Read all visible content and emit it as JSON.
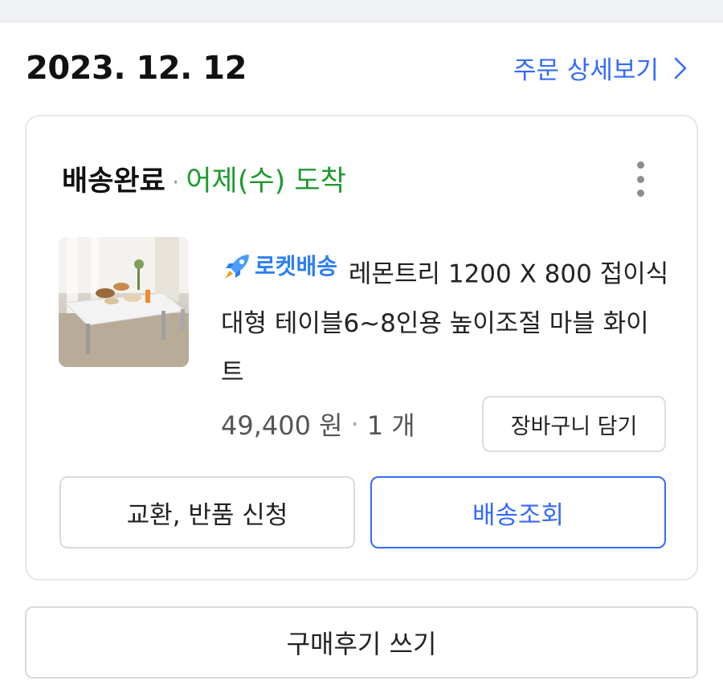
{
  "order": {
    "date": "2023. 12. 12",
    "detail_link": "주문 상세보기"
  },
  "card": {
    "status": "배송완료",
    "status_separator": "·",
    "arrival": "어제(수) 도착",
    "more_icon": "more-vertical-icon",
    "product": {
      "thumbnail_icon": "product-table-image",
      "badge_icon": "rocket-icon",
      "badge_label": "로켓배송",
      "title": "레몬트리 1200 X 800 접이식 대형 테이블6~8인용 높이조절 마블 화이트",
      "price": "49,400 원",
      "separator": "·",
      "quantity": "1 개"
    },
    "cart_button": "장바구니 담기",
    "return_button": "교환, 반품 신청",
    "track_button": "배송조회"
  },
  "review_button": "구매후기 쓰기",
  "colors": {
    "accent_blue": "#346aff",
    "arrival_green": "#1c9b2d",
    "rocket_blue": "#2c7ff5",
    "top_band": "#f0f1f3"
  }
}
